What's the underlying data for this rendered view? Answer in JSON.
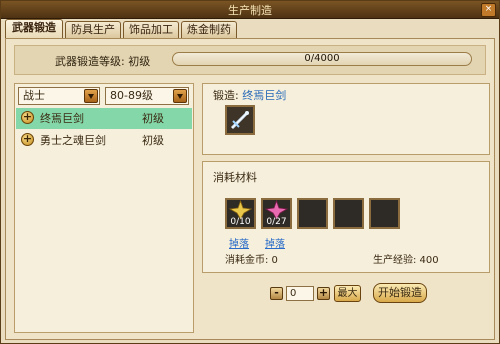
{
  "window": {
    "title": "生产制造",
    "close_label": "×"
  },
  "tabs": [
    {
      "label": "武器锻造",
      "active": true
    },
    {
      "label": "防具生产",
      "active": false
    },
    {
      "label": "饰品加工",
      "active": false
    },
    {
      "label": "炼金制药",
      "active": false
    }
  ],
  "level": {
    "label": "武器锻造等级: 初级",
    "progress_text": "0/4000",
    "progress_fraction": 0
  },
  "filters": {
    "class_value": "战士",
    "level_value": "80-89级"
  },
  "recipes": [
    {
      "name": "终焉巨剑",
      "grade": "初级",
      "selected": true,
      "expand_label": "+"
    },
    {
      "name": "勇士之魂巨剑",
      "grade": "初级",
      "selected": false,
      "expand_label": "+"
    }
  ],
  "forge": {
    "prefix": "锻造: ",
    "item_name": "终焉巨剑",
    "icon": "sword-icon"
  },
  "materials": {
    "title": "消耗材料",
    "slots": [
      {
        "count": "0/10",
        "icon": "gold-star-icon",
        "color": "#e8c74a"
      },
      {
        "count": "0/27",
        "icon": "pink-star-icon",
        "color": "#e86ab0"
      },
      {
        "count": "",
        "icon": ""
      },
      {
        "count": "",
        "icon": ""
      },
      {
        "count": "",
        "icon": ""
      }
    ],
    "drop_links": [
      "掉落",
      "掉落"
    ],
    "gold_cost": "消耗金币: 0",
    "exp_gain": "生产经验: 400"
  },
  "actions": {
    "minus": "-",
    "plus": "+",
    "quantity": "0",
    "max": "最大",
    "start": "开始锻造"
  }
}
